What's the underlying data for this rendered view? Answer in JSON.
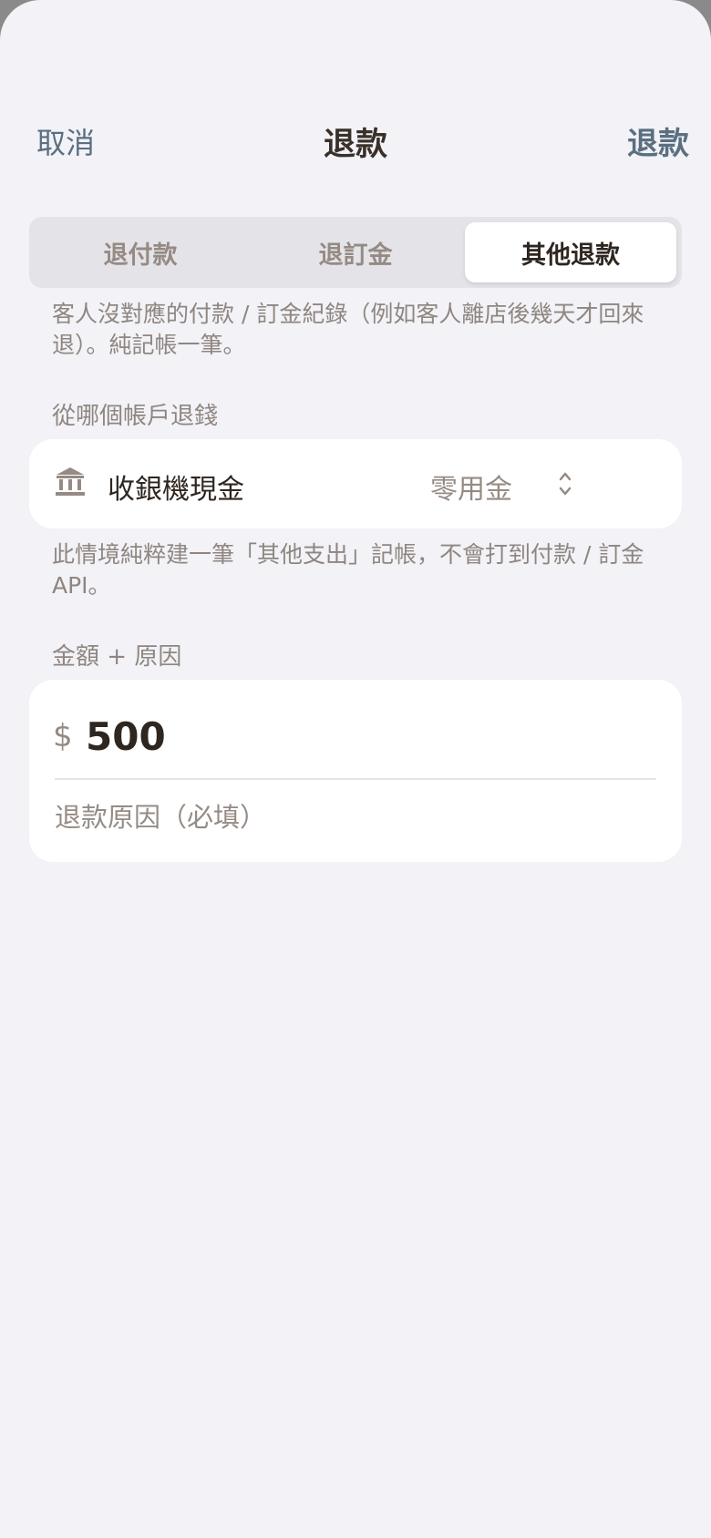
{
  "header": {
    "cancel_label": "取消",
    "title": "退款",
    "confirm_label": "退款"
  },
  "tabs": [
    {
      "label": "退付款",
      "selected": false
    },
    {
      "label": "退訂金",
      "selected": false
    },
    {
      "label": "其他退款",
      "selected": true
    }
  ],
  "mode_description": "客人沒對應的付款 / 訂金紀錄（例如客人離店後幾天才回來退）。純記帳一筆。",
  "account_section": {
    "label": "從哪個帳戶退錢",
    "icon": "bank-icon",
    "account_name": "收銀機現金",
    "selected_account": "零用金",
    "selector_icon": "chevron-up-down-icon"
  },
  "account_note": "此情境純粹建一筆「其他支出」記帳，不會打到付款 / 訂金 API。",
  "amount_section": {
    "label": "金額 + 原因",
    "currency_symbol": "$",
    "amount_value": "500",
    "reason_value": "",
    "reason_placeholder": "退款原因（必填）"
  },
  "colors": {
    "background": "#f2f2f7",
    "accent": "#5a6f80",
    "primary_text": "#2e2620",
    "secondary_text": "#8f8680",
    "card": "#ffffff"
  }
}
